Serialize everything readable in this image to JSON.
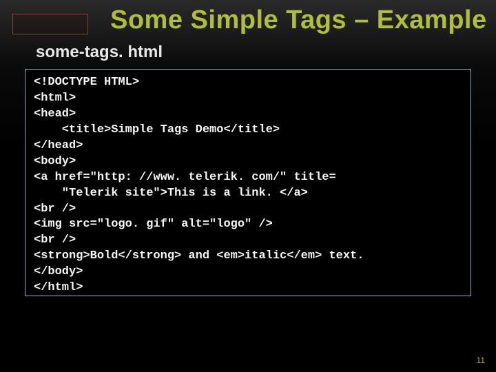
{
  "title": "Some Simple Tags – Example",
  "filename": "some-tags. html",
  "code": "<!DOCTYPE HTML>\n<html>\n<head>\n    <title>Simple Tags Demo</title>\n</head>\n<body>\n<a href=\"http: //www. telerik. com/\" title=\n    \"Telerik site\">This is a link. </a>\n<br />\n<img src=\"logo. gif\" alt=\"logo\" />\n<br />\n<strong>Bold</strong> and <em>italic</em> text.\n</body>\n</html>",
  "page_number": "11"
}
